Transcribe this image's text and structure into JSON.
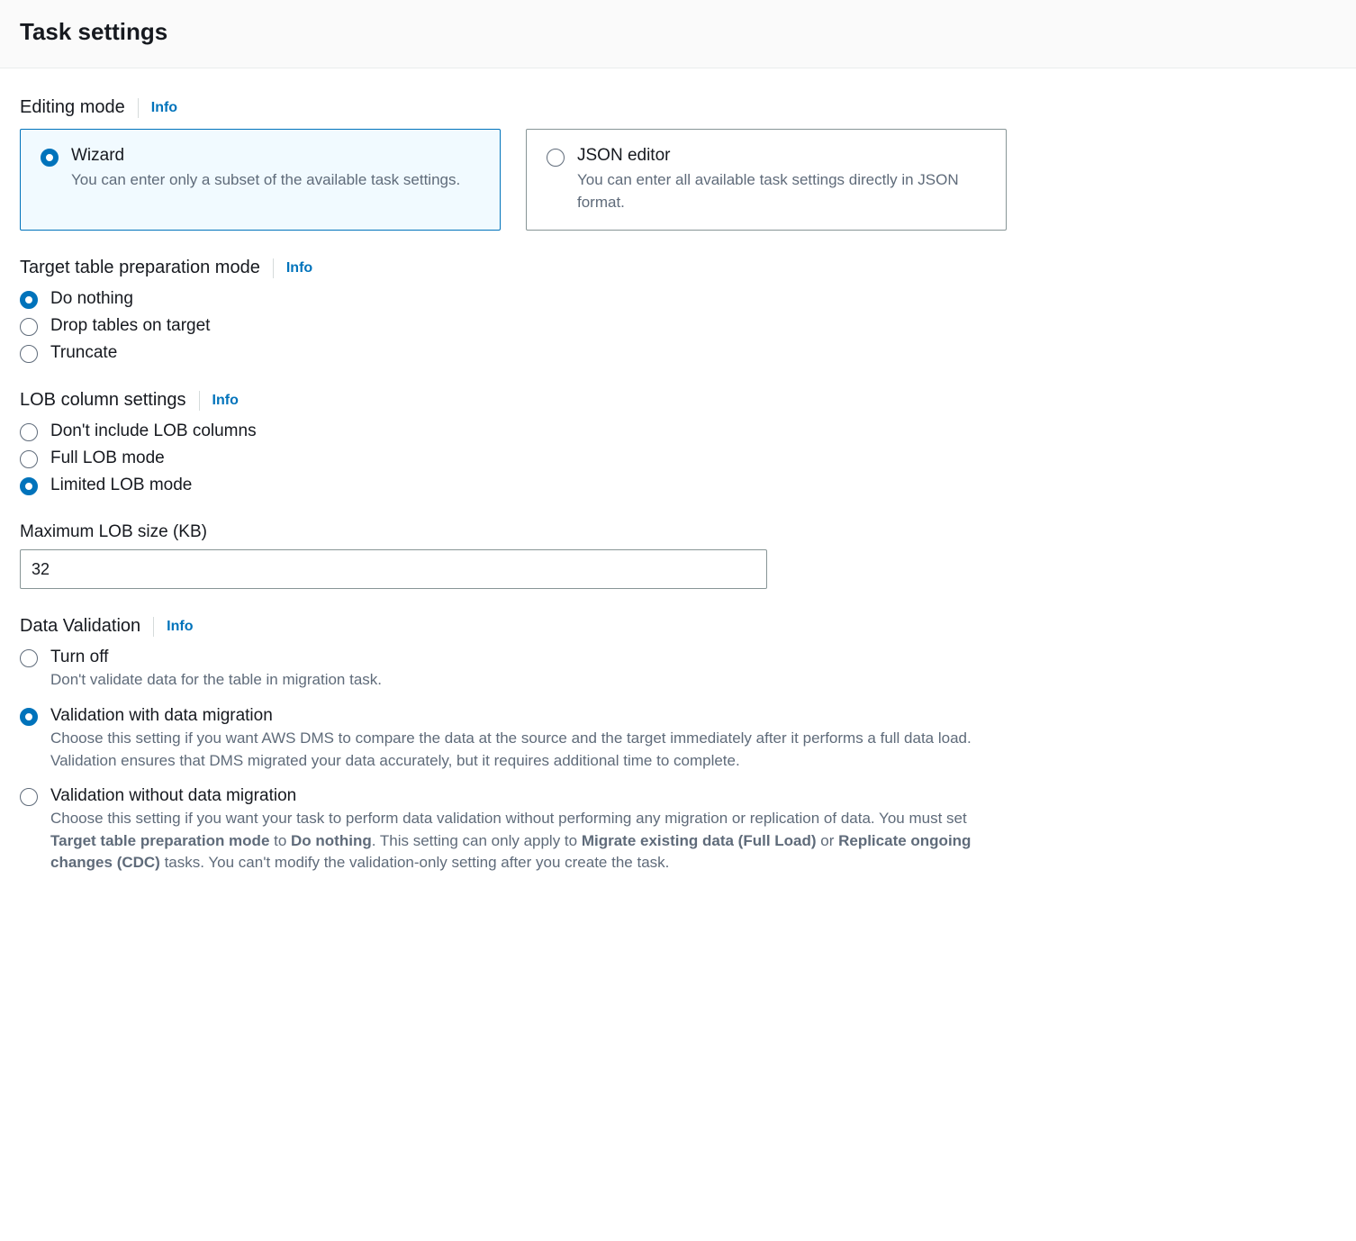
{
  "header": {
    "title": "Task settings"
  },
  "editingMode": {
    "title": "Editing mode",
    "info": "Info",
    "options": [
      {
        "label": "Wizard",
        "desc": "You can enter only a subset of the available task settings.",
        "selected": true
      },
      {
        "label": "JSON editor",
        "desc": "You can enter all available task settings directly in JSON format.",
        "selected": false
      }
    ]
  },
  "targetPrep": {
    "title": "Target table preparation mode",
    "info": "Info",
    "options": [
      {
        "label": "Do nothing",
        "selected": true
      },
      {
        "label": "Drop tables on target",
        "selected": false
      },
      {
        "label": "Truncate",
        "selected": false
      }
    ]
  },
  "lob": {
    "title": "LOB column settings",
    "info": "Info",
    "options": [
      {
        "label": "Don't include LOB columns",
        "selected": false
      },
      {
        "label": "Full LOB mode",
        "selected": false
      },
      {
        "label": "Limited LOB mode",
        "selected": true
      }
    ]
  },
  "maxLob": {
    "label": "Maximum LOB size (KB)",
    "value": "32"
  },
  "validation": {
    "title": "Data Validation",
    "info": "Info",
    "options": [
      {
        "label": "Turn off",
        "desc_parts": [
          "Don't validate data for the table in migration task."
        ],
        "selected": false
      },
      {
        "label": "Validation with data migration",
        "desc_parts": [
          "Choose this setting if you want AWS DMS to compare the data at the source and the target immediately after it performs a full data load. Validation ensures that DMS migrated your data accurately, but it requires additional time to complete."
        ],
        "selected": true
      },
      {
        "label": "Validation without data migration",
        "desc_parts": [
          "Choose this setting if you want your task to perform data validation without performing any migration or replication of data. You must set ",
          "Target table preparation mode",
          " to ",
          "Do nothing",
          ". This setting can only apply to ",
          "Migrate existing data (Full Load)",
          " or ",
          "Replicate ongoing changes (CDC)",
          " tasks. You can't modify the validation-only setting after you create the task."
        ],
        "selected": false
      }
    ]
  }
}
